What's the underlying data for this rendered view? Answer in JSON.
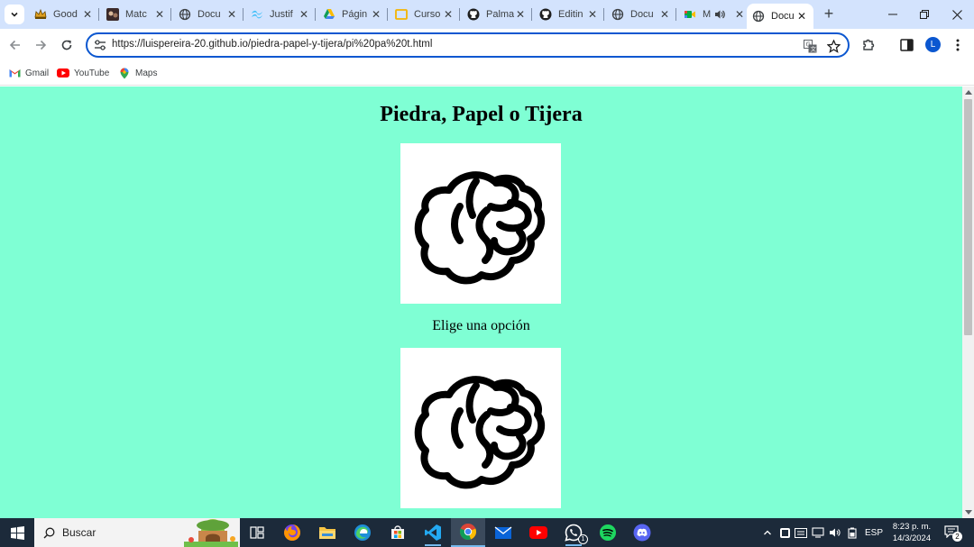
{
  "browser": {
    "tabs": [
      {
        "title": "Good",
        "icon": "crown-favicon-icon"
      },
      {
        "title": "Matc",
        "icon": "match-favicon-icon"
      },
      {
        "title": "Docu",
        "icon": "globe-favicon-icon"
      },
      {
        "title": "Justif",
        "icon": "tailwind-favicon-icon"
      },
      {
        "title": "Págin",
        "icon": "drive-favicon-icon"
      },
      {
        "title": "Curso",
        "icon": "course-favicon-icon"
      },
      {
        "title": "Palma",
        "icon": "github-favicon-icon"
      },
      {
        "title": "Editin",
        "icon": "github-favicon-icon"
      },
      {
        "title": "Docu",
        "icon": "globe-favicon-icon"
      },
      {
        "title": "M",
        "icon": "meet-favicon-icon",
        "audio": true
      },
      {
        "title": "Docu",
        "icon": "globe-favicon-icon",
        "active": true
      }
    ],
    "new_tab_label": "+",
    "url": "https://luispereira-20.github.io/piedra-papel-y-tijera/pi%20pa%20t.html",
    "profile_initial": "L",
    "bookmarks": [
      {
        "label": "Gmail",
        "icon": "gmail-icon"
      },
      {
        "label": "YouTube",
        "icon": "youtube-icon"
      },
      {
        "label": "Maps",
        "icon": "maps-icon"
      }
    ]
  },
  "page": {
    "background": "#7fffd4",
    "title": "Piedra, Papel o Tijera",
    "prompt": "Elige una opción",
    "images": [
      {
        "name": "computer-choice-rock-image",
        "icon": "fist-rock-icon"
      },
      {
        "name": "player-choice-rock-image",
        "icon": "fist-rock-icon"
      }
    ]
  },
  "taskbar": {
    "search_label": "Buscar",
    "apps": [
      "task-view",
      "firefox",
      "file-explorer",
      "edge",
      "microsoft-store",
      "vscode",
      "chrome",
      "mail",
      "youtube",
      "whatsapp",
      "spotify",
      "discord"
    ],
    "whatsapp_badge": "1",
    "language": "ESP",
    "time": "8:23 p. m.",
    "date": "14/3/2024",
    "notification_count": "2"
  },
  "colors": {
    "tabstrip": "#d3e3fd",
    "accent": "#0b57d0",
    "taskbar": "#1c2a3a"
  }
}
